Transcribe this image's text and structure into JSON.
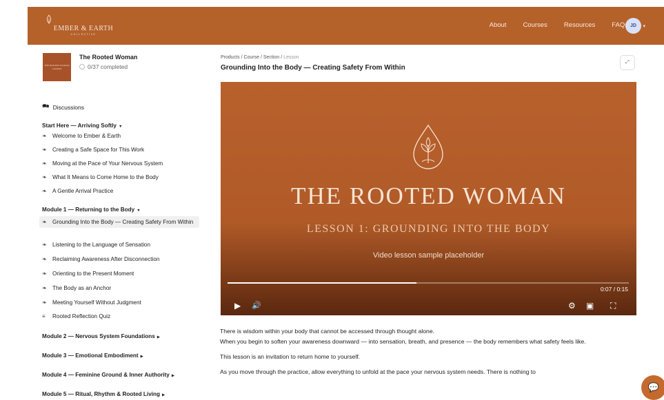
{
  "header": {
    "logo_text": "EMBER & EARTH",
    "logo_sub": "COLLECTIVE",
    "nav": [
      "About",
      "Courses",
      "Resources",
      "FAQs"
    ],
    "avatar_initials": "JD",
    "brand_color": "#b5612a"
  },
  "sidebar": {
    "course_thumb_text": "THE ROOTED WOMAN COURSE",
    "course_title": "The Rooted Woman",
    "progress": "0/37 completed",
    "discussions": "Discussions",
    "sections": [
      {
        "title": "Start Here — Arriving Softly",
        "expanded": true,
        "lessons": [
          "Welcome to Ember & Earth",
          "Creating a Safe Space for This Work",
          "Moving at the Pace of Your Nervous System",
          "What It Means to Come Home to the Body",
          "A Gentle Arrival Practice"
        ]
      },
      {
        "title": "Module 1 — Returning to the Body",
        "expanded": true,
        "lessons": [
          "Grounding Into the Body — Creating Safety From Within",
          "Listening to the Language of Sensation",
          "Reclaiming Awareness After Disconnection",
          "Orienting to the Present Moment",
          "The Body as an Anchor",
          "Meeting Yourself Without Judgment",
          "Rooted Reflection Quiz"
        ]
      },
      {
        "title": "Module 2 — Nervous System Foundations",
        "expanded": false
      },
      {
        "title": "Module 3 — Emotional Embodiment",
        "expanded": false
      },
      {
        "title": "Module 4 — Feminine Ground & Inner Authority",
        "expanded": false
      },
      {
        "title": "Module 5 — Ritual, Rhythm & Rooted Living",
        "expanded": false
      }
    ]
  },
  "main": {
    "breadcrumb": [
      "Products",
      "Course",
      "Section",
      "Lesson"
    ],
    "lesson_title": "Grounding Into the Body — Creating Safety From Within",
    "video": {
      "title": "THE ROOTED WOMAN",
      "subtitle": "LESSON 1: GROUNDING INTO THE BODY",
      "placeholder": "Video lesson sample placeholder",
      "time": "0:07 / 0:15",
      "progress": 0.47
    },
    "paragraphs": [
      "There is wisdom within your body that cannot be accessed through thought alone.",
      "When you begin to soften your awareness downward — into sensation, breath, and presence — the body remembers what safety feels like.",
      "This lesson is an invitation to return home to yourself.",
      "As you move through the practice, allow everything to unfold at the pace your nervous system needs. There is nothing to"
    ]
  }
}
